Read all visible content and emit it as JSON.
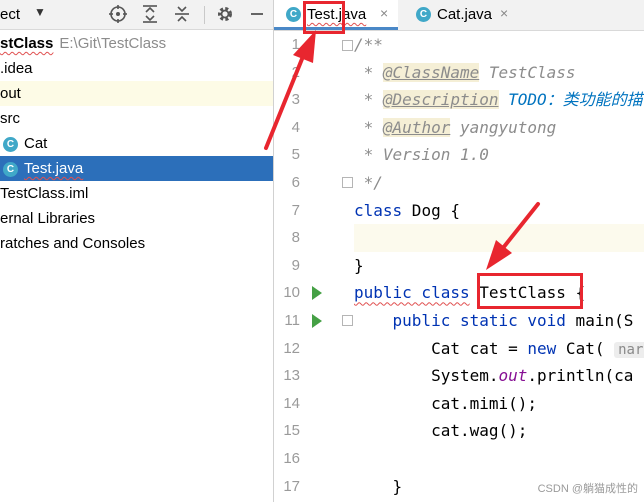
{
  "project_panel": {
    "title": "ect",
    "toolbar_icons": [
      "target-icon",
      "expand-all-icon",
      "collapse-all-icon",
      "gear-icon",
      "minimize-icon"
    ],
    "tree": [
      {
        "label": "stClass",
        "path": "E:\\Git\\TestClass",
        "bold": true,
        "wavy": true
      },
      {
        "label": ".idea"
      },
      {
        "label": "out",
        "highlight": "out"
      },
      {
        "label": "src"
      },
      {
        "label": "Cat",
        "icon": "C"
      },
      {
        "label": "Test.java",
        "icon": "C",
        "selected": true,
        "wavy": true
      },
      {
        "label": "TestClass.iml"
      },
      {
        "label": "ernal Libraries"
      },
      {
        "label": "ratches and Consoles"
      }
    ]
  },
  "tabs": [
    {
      "label": "Test.java",
      "icon": "C",
      "active": true
    },
    {
      "label": "Cat.java",
      "icon": "C",
      "active": false
    }
  ],
  "tab_close_glyph": "×",
  "line_numbers": [
    "1",
    "2",
    "3",
    "4",
    "5",
    "6",
    "7",
    "8",
    "9",
    "10",
    "11",
    "12",
    "13",
    "14",
    "15",
    "16",
    "17"
  ],
  "code": {
    "l1": "/**",
    "l2_star": " * ",
    "l2_tag": "@ClassName",
    "l2_val": " TestClass",
    "l3_star": " * ",
    "l3_tag": "@Description",
    "l3_val": " TODO：类功能的描",
    "l4_star": " * ",
    "l4_tag": "@Author",
    "l4_val": " yangyutong",
    "l5": " * Version 1.0",
    "l6": " */",
    "l7_kw": "class",
    "l7_rest": " Dog {",
    "l9": "}",
    "l10_kw": "public class",
    "l10_name": " TestClass",
    "l10_rest": " {",
    "l11_indent": "    ",
    "l11_kw": "public static void",
    "l11_rest": " main(S",
    "l12_a": "        Cat cat = ",
    "l12_kw": "new",
    "l12_b": " Cat( ",
    "l12_hint": "nar",
    "l13_a": "        System.",
    "l13_field": "out",
    "l13_b": ".println(ca",
    "l14": "        cat.mimi();",
    "l15": "        cat.wag();",
    "l17": "    }"
  },
  "watermark": "CSDN @躺猫成性的"
}
